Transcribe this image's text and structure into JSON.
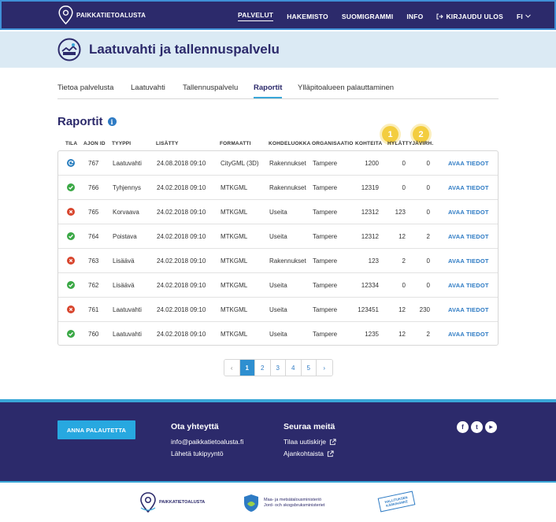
{
  "header": {
    "logo_text": "PAIKKATIETOALUSTA",
    "nav": [
      {
        "label": "PALVELUT",
        "active": true
      },
      {
        "label": "HAKEMISTO"
      },
      {
        "label": "SUOMIGRAMMI"
      },
      {
        "label": "INFO"
      }
    ],
    "login_label": "KIRJAUDU ULOS",
    "language": "FI"
  },
  "hero": {
    "title": "Laatuvahti ja tallennuspalvelu"
  },
  "tabs": [
    {
      "label": "Tietoa palvelusta"
    },
    {
      "label": "Laatuvahti"
    },
    {
      "label": "Tallennuspalvelu"
    },
    {
      "label": "Raportit",
      "active": true
    },
    {
      "label": "Ylläpitoalueen palauttaminen"
    }
  ],
  "section": {
    "title": "Raportit"
  },
  "badges": [
    "1",
    "2"
  ],
  "table": {
    "headers": [
      "TILA",
      "AJON ID",
      "TYYPPI",
      "LISÄTTY",
      "FORMAATTI",
      "KOHDELUOKKA",
      "ORGANISAATIO",
      "KOHTEITA",
      "HYLÄTTYJÄ",
      "VIRH."
    ],
    "rows": [
      {
        "status": "processing",
        "id": "767",
        "type": "Laatuvahti",
        "date": "24.08.2018  09:10",
        "format": "CityGML (3D)",
        "class": "Rakennukset",
        "org": "Tampere",
        "features": "1200",
        "rejected": "0",
        "errors": "0",
        "link": "AVAA TIEDOT"
      },
      {
        "status": "ok",
        "id": "766",
        "type": "Tyhjennys",
        "date": "24.02.2018  09:10",
        "format": "MTKGML",
        "class": "Rakennukset",
        "org": "Tampere",
        "features": "12319",
        "rejected": "0",
        "errors": "0",
        "link": "AVAA TIEDOT"
      },
      {
        "status": "error",
        "id": "765",
        "type": "Korvaava",
        "date": "24.02.2018  09:10",
        "format": "MTKGML",
        "class": "Useita",
        "org": "Tampere",
        "features": "12312",
        "rejected": "123",
        "errors": "0",
        "link": "AVAA TIEDOT"
      },
      {
        "status": "ok",
        "id": "764",
        "type": "Poistava",
        "date": "24.02.2018  09:10",
        "format": "MTKGML",
        "class": "Useita",
        "org": "Tampere",
        "features": "12312",
        "rejected": "12",
        "errors": "2",
        "link": "AVAA TIEDOT"
      },
      {
        "status": "error",
        "id": "763",
        "type": "Lisäävä",
        "date": "24.02.2018  09:10",
        "format": "MTKGML",
        "class": "Rakennukset",
        "org": "Tampere",
        "features": "123",
        "rejected": "2",
        "errors": "0",
        "link": "AVAA TIEDOT"
      },
      {
        "status": "ok",
        "id": "762",
        "type": "Lisäävä",
        "date": "24.02.2018  09:10",
        "format": "MTKGML",
        "class": "Useita",
        "org": "Tampere",
        "features": "12334",
        "rejected": "0",
        "errors": "0",
        "link": "AVAA TIEDOT"
      },
      {
        "status": "error",
        "id": "761",
        "type": "Laatuvahti",
        "date": "24.02.2018  09:10",
        "format": "MTKGML",
        "class": "Useita",
        "org": "Tampere",
        "features": "123451",
        "rejected": "12",
        "errors": "230",
        "link": "AVAA TIEDOT"
      },
      {
        "status": "ok",
        "id": "760",
        "type": "Laatuvahti",
        "date": "24.02.2018  09:10",
        "format": "MTKGML",
        "class": "Useita",
        "org": "Tampere",
        "features": "1235",
        "rejected": "12",
        "errors": "2",
        "link": "AVAA TIEDOT"
      }
    ]
  },
  "pagination": {
    "prev": "‹",
    "pages": [
      "1",
      "2",
      "3",
      "4",
      "5"
    ],
    "current": "1",
    "next": "›"
  },
  "footer": {
    "feedback_button": "ANNA PALAUTETTA",
    "contact": {
      "title": "Ota yhteyttä",
      "email": "info@paikkatietoalusta.fi",
      "support": "Lähetä tukipyyntö"
    },
    "follow": {
      "title": "Seuraa meitä",
      "newsletter": "Tilaa uutiskirje",
      "current": "Ajankohtaista"
    },
    "social": [
      "f",
      "t",
      "▶"
    ]
  },
  "partners": {
    "logo1": "PAIKKATIETOALUSTA",
    "ministry_line1": "Maa- ja metsätalousministeriö",
    "ministry_line2": "Jord- och skogsbruksministeriet",
    "stamp_line1": "HALLITUKSEN",
    "stamp_line2": "KÄRKIHANKE"
  },
  "colors": {
    "brand": "#2c2a6b",
    "accent": "#3aa7d8",
    "link": "#2e7bc4",
    "ok": "#3aa845",
    "error": "#d8452d",
    "badge": "#f3cd3f"
  }
}
